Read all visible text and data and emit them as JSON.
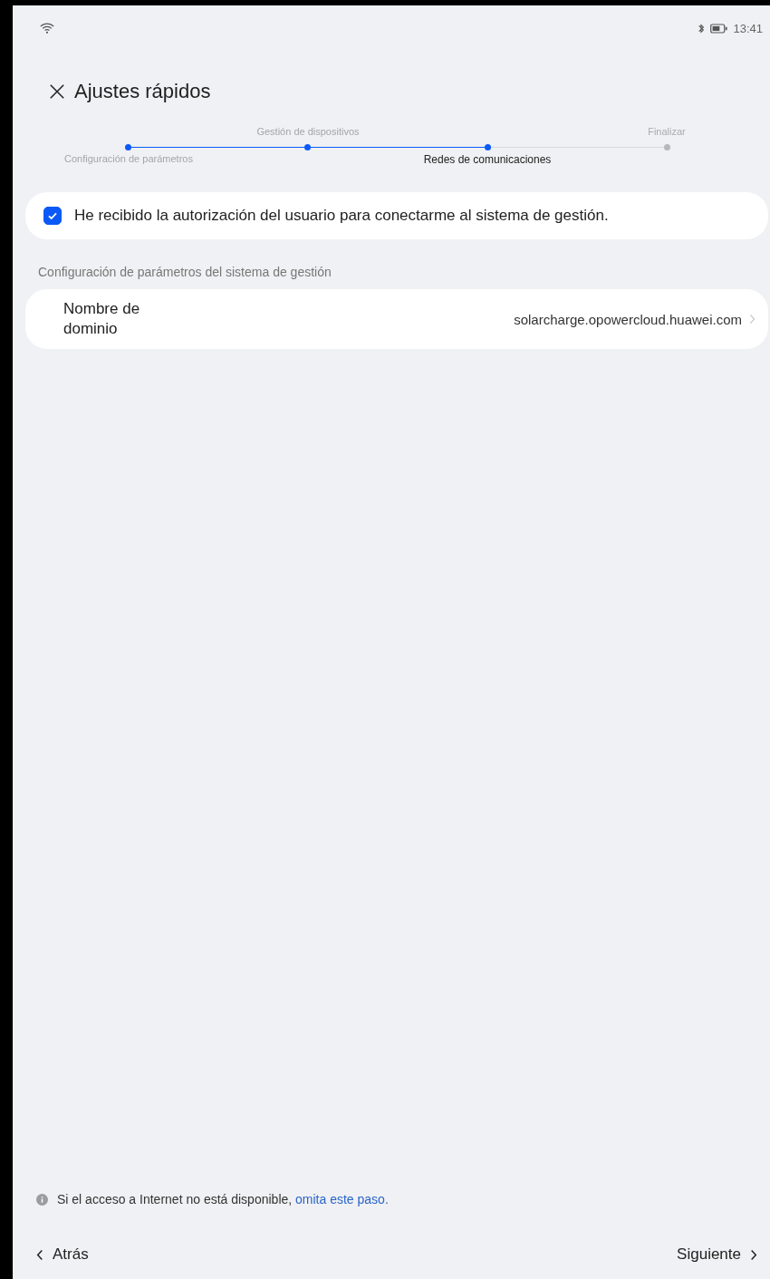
{
  "status_bar": {
    "time": "13:41"
  },
  "header": {
    "title": "Ajustes rápidos"
  },
  "steps": [
    {
      "label": "Configuración de parámetros",
      "done": true,
      "selected": false
    },
    {
      "label": "Gestión de dispositivos",
      "done": true,
      "selected": false
    },
    {
      "label": "Redes de comunicaciones",
      "done": false,
      "selected": true
    },
    {
      "label": "Finalizar",
      "done": false,
      "selected": false
    }
  ],
  "authorization": {
    "label": "He recibido la autorización del usuario para conectarme al sistema de gestión.",
    "checked": true
  },
  "section_title": "Configuración de parámetros del sistema de gestión",
  "settings": [
    {
      "label": "Nombre de dominio",
      "value": "solarcharge.opowercloud.huawei.com"
    }
  ],
  "notice": {
    "text": "Si el acceso a Internet no está disponible,",
    "link": "omita este paso."
  },
  "footer": {
    "back": "Atrás",
    "next": "Siguiente"
  }
}
